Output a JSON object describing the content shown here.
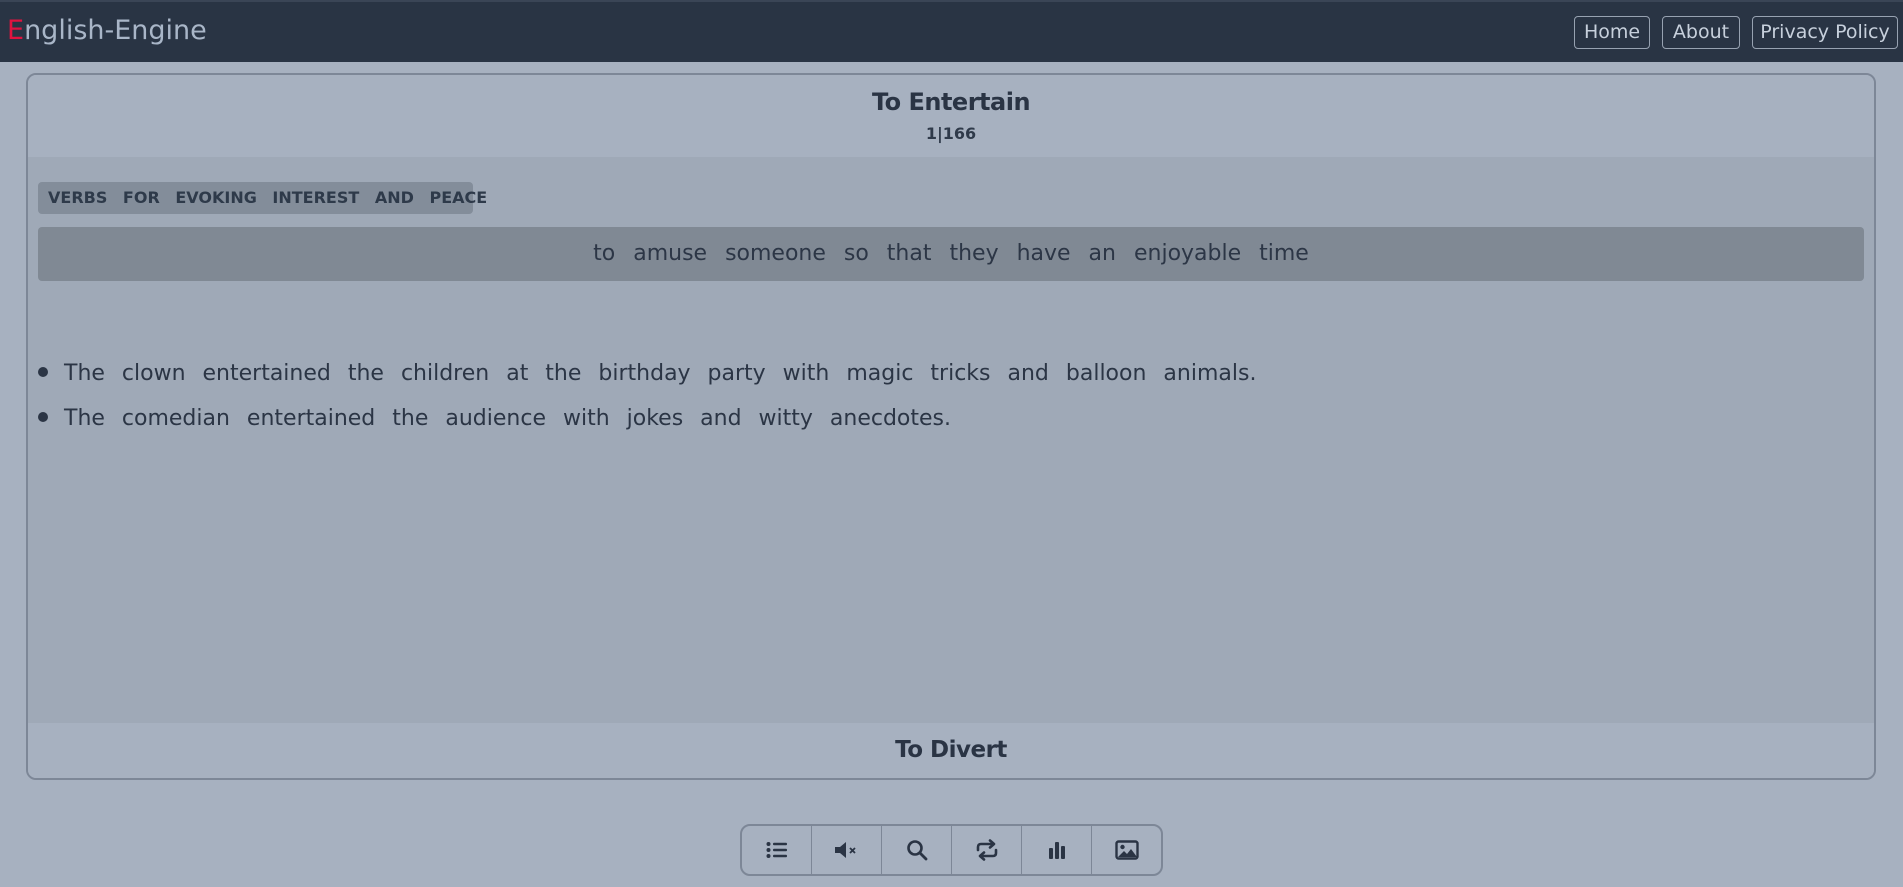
{
  "navbar": {
    "brand_first": "E",
    "brand_rest": "nglish-Engine",
    "links": {
      "home": "Home",
      "about": "About",
      "privacy": "Privacy Policy"
    }
  },
  "card": {
    "title": "To Entertain",
    "counter": "1|166",
    "category": "VERBS FOR EVOKING INTEREST AND PEACE",
    "definition": "to amuse someone so that they have an enjoyable time",
    "examples": [
      "The clown entertained the children at the birthday party with magic tricks and balloon animals.",
      "The comedian entertained the audience with jokes and witty anecdotes."
    ],
    "next_word": "To Divert"
  },
  "toolbar": {
    "icons": [
      "list-icon",
      "mute-icon",
      "search-icon",
      "repeat-icon",
      "stats-icon",
      "image-icon"
    ]
  },
  "colors": {
    "navbar_bg": "#293444",
    "brand_accent": "#e0133f",
    "page_bg": "#a7b1c0",
    "text": "#2a3444"
  }
}
